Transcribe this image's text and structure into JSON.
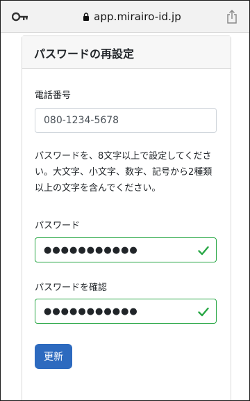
{
  "browser": {
    "url": "app.mirairo-id.jp",
    "key_icon": "key-icon",
    "lock_icon": "lock-icon",
    "share_icon": "share-icon"
  },
  "card": {
    "title": "パスワードの再設定"
  },
  "form": {
    "phone_label": "電話番号",
    "phone_value": "080-1234-5678",
    "help_text": "パスワードを、8文字以上で設定してください。大文字、小文字、数字、記号から2種類以上の文字を含んでください。",
    "password_label": "パスワード",
    "password_value": "●●●●●●●●●●●",
    "confirm_label": "パスワードを確認",
    "confirm_value": "●●●●●●●●●●●",
    "valid_color": "#28a745",
    "submit_label": "更新",
    "submit_color": "#2d6abf"
  }
}
